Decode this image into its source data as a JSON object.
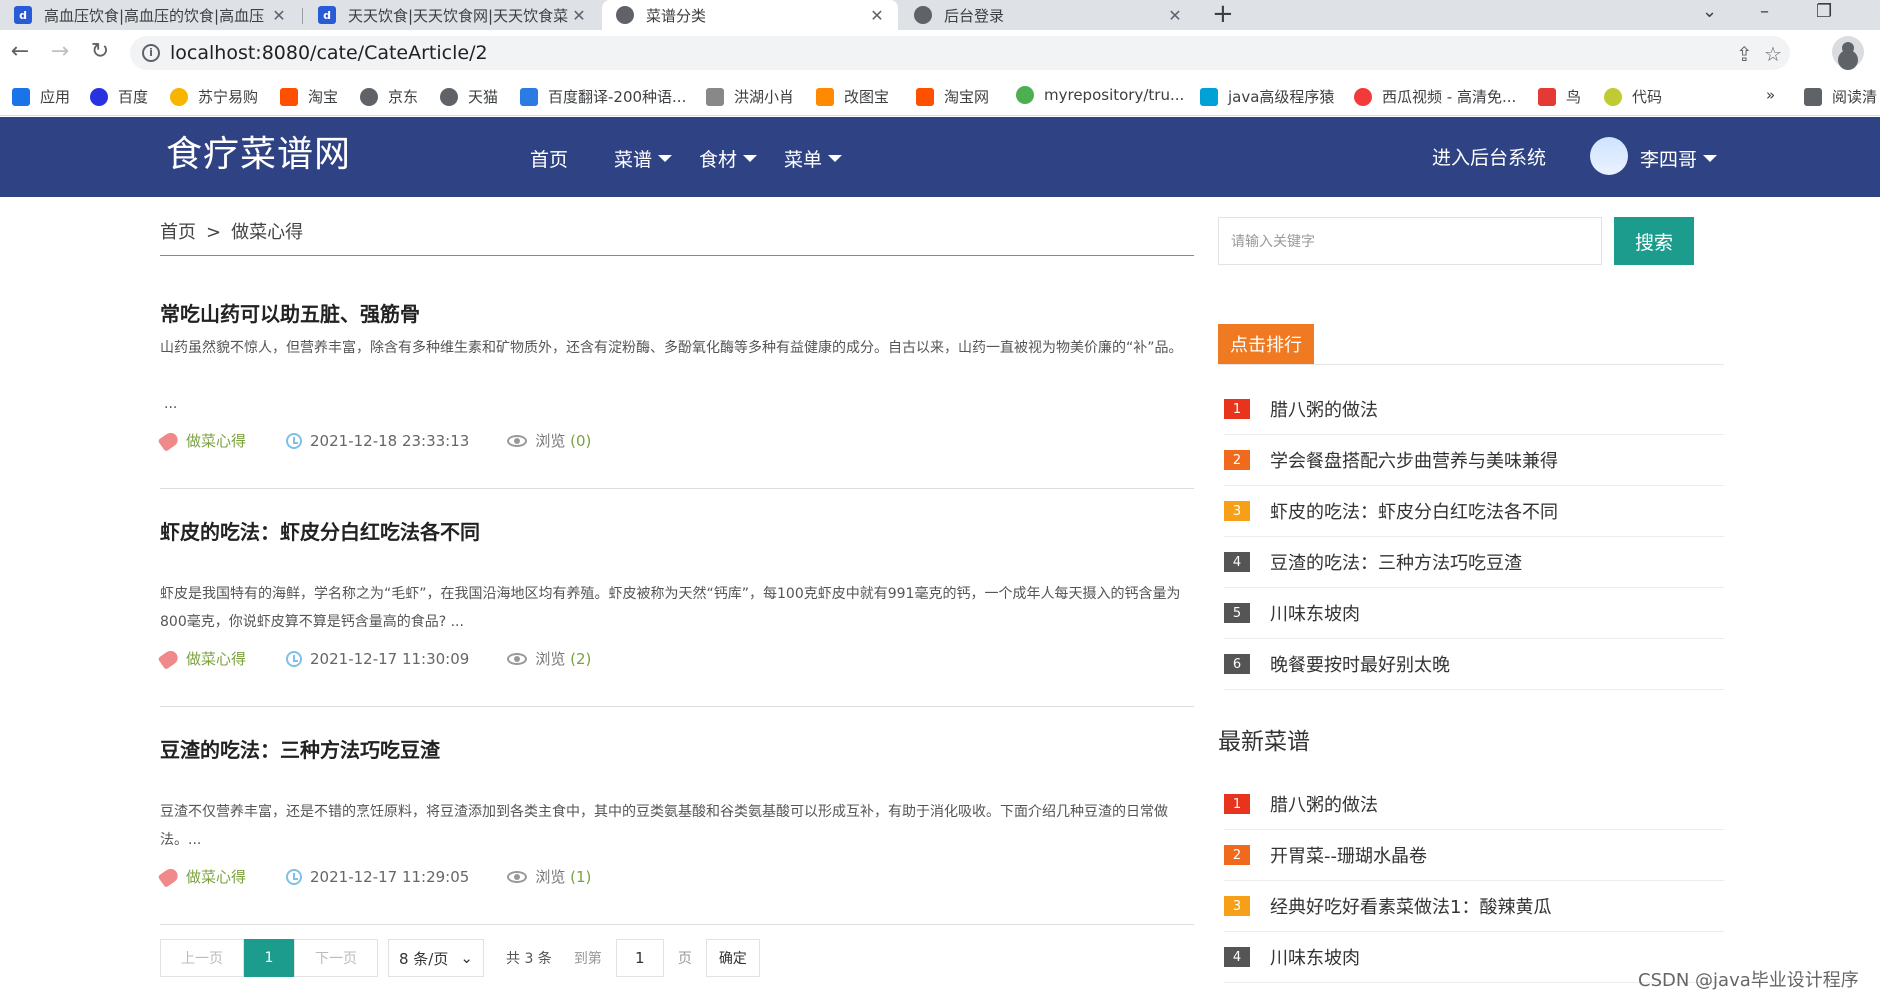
{
  "browser": {
    "tabs": [
      {
        "title": "高血压饮食|高血压的饮食|高血压",
        "favicon": "blue"
      },
      {
        "title": "天天饮食|天天饮食网|天天饮食菜",
        "favicon": "blue"
      },
      {
        "title": "菜谱分类",
        "favicon": "globe"
      },
      {
        "title": "后台登录",
        "favicon": "globe"
      }
    ],
    "url": "localhost:8080/cate/CateArticle/2",
    "bookmarks": [
      {
        "label": "应用",
        "color": "#1a73e8"
      },
      {
        "label": "百度",
        "color": "#2932e1"
      },
      {
        "label": "苏宁易购",
        "color": "#f7b500"
      },
      {
        "label": "淘宝",
        "color": "#ff5000"
      },
      {
        "label": "京东",
        "color": "#5f6368"
      },
      {
        "label": "天猫",
        "color": "#5f6368"
      },
      {
        "label": "百度翻译-200种语...",
        "color": "#2a7be4"
      },
      {
        "label": "洪湖小肖",
        "color": "#888888"
      },
      {
        "label": "改图宝",
        "color": "#ff8a00"
      },
      {
        "label": "淘宝网",
        "color": "#ff5000"
      },
      {
        "label": "myrepository/tru...",
        "color": "#4caf50"
      },
      {
        "label": "java高级程序猿",
        "color": "#00a1d6"
      },
      {
        "label": "西瓜视频 - 高清免...",
        "color": "#f33a3a"
      },
      {
        "label": "鸟",
        "color": "#e53935"
      },
      {
        "label": "代码",
        "color": "#c0ca33"
      },
      {
        "label": "阅读清",
        "color": "#5f6368"
      }
    ]
  },
  "site": {
    "logo": "食疗菜谱网",
    "nav": [
      {
        "label": "首页",
        "dropdown": false
      },
      {
        "label": "菜谱",
        "dropdown": true
      },
      {
        "label": "食材",
        "dropdown": true
      },
      {
        "label": "菜单",
        "dropdown": true
      }
    ],
    "admin_link": "进入后台系统",
    "username": "李四哥"
  },
  "breadcrumb": {
    "home": "首页",
    "sep": ">",
    "current": "做菜心得"
  },
  "articles": [
    {
      "title": "常吃山药可以助五脏、强筋骨",
      "summary": " 山药虽然貌不惊人，但营养丰富，除含有多种维生素和矿物质外，还含有淀粉酶、多酚氧化酶等多种有益健康的成分。自古以来，山药一直被视为物美价廉的“补”品。",
      "ellipsis": "...",
      "category": "做菜心得",
      "date": "2021-12-18 23:33:13",
      "views_label": "浏览",
      "views": "(0)"
    },
    {
      "title": "虾皮的吃法：虾皮分白红吃法各不同",
      "summary": "      虾皮是我国特有的海鲜，学名称之为“毛虾”，在我国沿海地区均有养殖。虾皮被称为天然“钙库”，每100克虾皮中就有991毫克的钙，一个成年人每天摄入的钙含量为800毫克，你说虾皮算不算是钙含量高的食品? ...",
      "ellipsis": "",
      "category": "做菜心得",
      "date": "2021-12-17 11:30:09",
      "views_label": "浏览",
      "views": "(2)"
    },
    {
      "title": "豆渣的吃法：三种方法巧吃豆渣",
      "summary": "    豆渣不仅营养丰富，还是不错的烹饪原料，将豆渣添加到各类主食中，其中的豆类氨基酸和谷类氨基酸可以形成互补，有助于消化吸收。下面介绍几种豆渣的日常做法。...",
      "ellipsis": "",
      "category": "做菜心得",
      "date": "2021-12-17 11:29:05",
      "views_label": "浏览",
      "views": "(1)"
    }
  ],
  "pager": {
    "prev": "上一页",
    "current": "1",
    "next": "下一页",
    "per_page": "8 条/页",
    "total": "共 3 条",
    "goto": "到第",
    "goto_value": "1",
    "page_unit": "页",
    "confirm": "确定"
  },
  "sidebar": {
    "search_placeholder": "请输入关键字",
    "search_button": "搜索",
    "rank_title": "点击排行",
    "rank": [
      {
        "n": "1",
        "title": "腊八粥的做法",
        "color": "#e8341c"
      },
      {
        "n": "2",
        "title": "学会餐盘搭配六步曲营养与美味兼得",
        "color": "#f06a1e"
      },
      {
        "n": "3",
        "title": "虾皮的吃法：虾皮分白红吃法各不同",
        "color": "#f6a01a"
      },
      {
        "n": "4",
        "title": "豆渣的吃法：三种方法巧吃豆渣",
        "color": "#555555"
      },
      {
        "n": "5",
        "title": "川味东坡肉",
        "color": "#555555"
      },
      {
        "n": "6",
        "title": "晚餐要按时最好别太晚",
        "color": "#555555"
      }
    ],
    "latest_title": "最新菜谱",
    "latest": [
      {
        "n": "1",
        "title": "腊八粥的做法",
        "color": "#e8341c"
      },
      {
        "n": "2",
        "title": "开胃菜--珊瑚水晶卷",
        "color": "#f06a1e"
      },
      {
        "n": "3",
        "title": "经典好吃好看素菜做法1：酸辣黄瓜",
        "color": "#f6a01a"
      },
      {
        "n": "4",
        "title": "川味东坡肉",
        "color": "#555555"
      }
    ]
  },
  "watermark": "CSDN @java毕业设计程序"
}
